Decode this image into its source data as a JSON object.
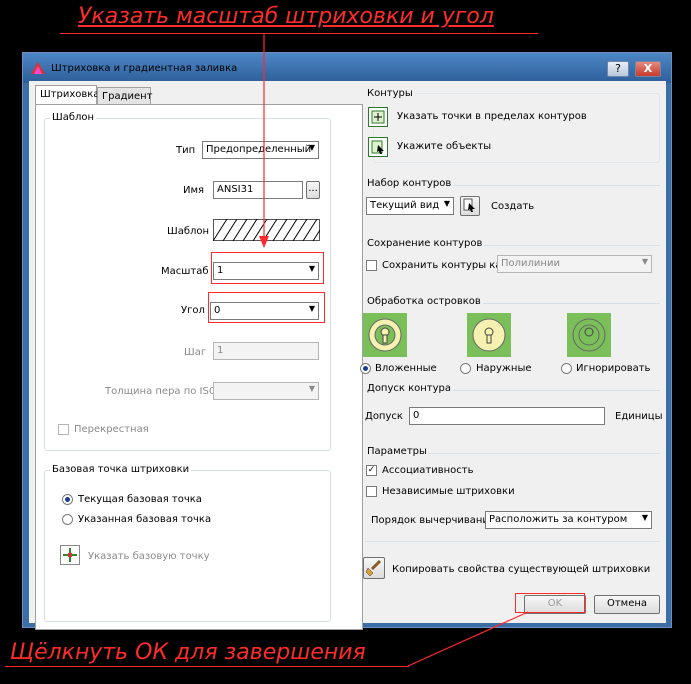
{
  "annotations": {
    "top": "Указать масштаб штриховки и угол",
    "bottom": "Щёлкнуть ОК для завершения"
  },
  "window": {
    "title": "Штриховка и градиентная заливка",
    "help_icon": "?",
    "close_icon": "X"
  },
  "tabs": [
    "Штриховка",
    "Градиент"
  ],
  "pattern": {
    "group_label": "Шаблон",
    "type_label": "Тип",
    "type_value": "Предопределенный",
    "name_label": "Имя",
    "name_value": "ANSI31",
    "browse_label": "...",
    "swatch_label": "Шаблон",
    "scale_label": "Масштаб",
    "scale_value": "1",
    "angle_label": "Угол",
    "angle_value": "0",
    "spacing_label": "Шаг",
    "spacing_value": "1",
    "iso_label": "Толщина пера по ISO",
    "cross_label": "Перекрестная"
  },
  "origin": {
    "group_label": "Базовая точка штриховки",
    "current_label": "Текущая базовая точка",
    "specified_label": "Указанная базовая точка",
    "pick_label": "Указать базовую точку"
  },
  "boundaries": {
    "group_label": "Контуры",
    "pick_points_label": "Указать точки в пределах контуров",
    "select_objects_label": "Укажите объекты"
  },
  "boundary_set": {
    "group_label": "Набор контуров",
    "combo_value": "Текущий вид",
    "create_label": "Создать"
  },
  "retain": {
    "group_label": "Сохранение контуров",
    "checkbox_label": "Сохранить контуры как",
    "combo_value": "Полилинии"
  },
  "islands": {
    "group_label": "Обработка островков",
    "normal_label": "Вложенные",
    "outer_label": "Наружные",
    "ignore_label": "Игнорировать"
  },
  "gap": {
    "group_label": "Допуск контура",
    "label": "Допуск",
    "value": "0",
    "units": "Единицы"
  },
  "options": {
    "group_label": "Параметры",
    "associative_label": "Ассоциативность",
    "separate_label": "Независимые штриховки",
    "draw_order_label": "Порядок вычерчивания",
    "draw_order_value": "Расположить за контуром"
  },
  "inherit_label": "Копировать свойства существующей штриховки",
  "buttons": {
    "ok": "OK",
    "cancel": "Отмена"
  },
  "colors": {
    "annotation": "#ff2a2a",
    "window_frame": "#3a6ea5",
    "island_green": "#7bbf5a"
  }
}
